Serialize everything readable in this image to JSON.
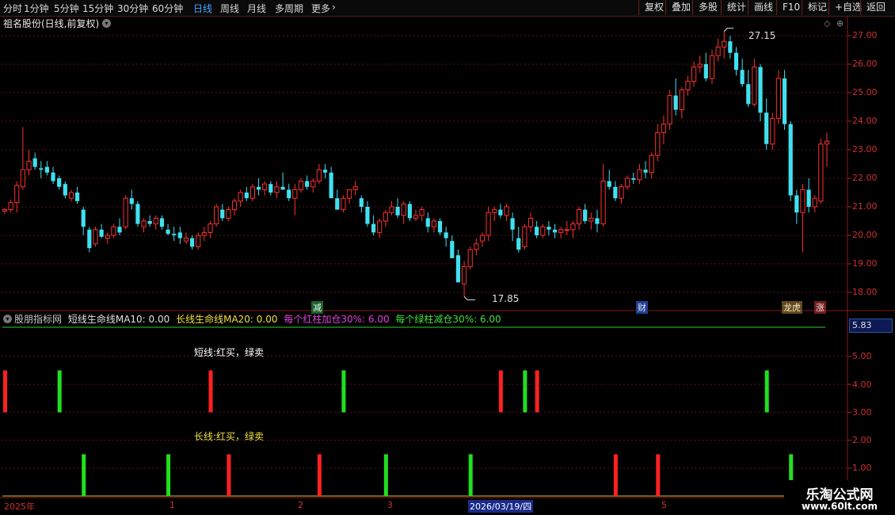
{
  "toolbar": {
    "periods": [
      "分时",
      "1分钟",
      "5分钟",
      "15分钟",
      "30分钟",
      "60分钟",
      "日线",
      "周线",
      "月线",
      "多周期",
      "更多"
    ],
    "active_period": "日线",
    "more_arrow": "›",
    "right_buttons": [
      "复权",
      "叠加",
      "多股",
      "统计",
      "画线",
      "F10",
      "标记",
      "+自选",
      "返回"
    ]
  },
  "stock": {
    "title": "祖名股份(日线,前复权)",
    "dropdown_icon": "chevron-down-icon"
  },
  "price_axis": {
    "ticks": [
      "27.00",
      "26.00",
      "25.00",
      "24.00",
      "23.00",
      "22.00",
      "21.00",
      "20.00",
      "19.00",
      "18.00"
    ]
  },
  "annotations": {
    "high": "27.15",
    "low": "17.85"
  },
  "event_badges": [
    {
      "text": "减",
      "color": "#2fa84f"
    },
    {
      "text": "财",
      "color": "#2f6fd6"
    },
    {
      "text": "龙虎",
      "color": "#b08a2f"
    },
    {
      "text": "涨",
      "color": "#d03030"
    }
  ],
  "indicator": {
    "name": "股朋指标网",
    "items": [
      {
        "text": "短线生命线MA10: 0.00",
        "color": "#e0e0e0"
      },
      {
        "text": "长线生命线MA20: 0.00",
        "color": "#f0e040"
      },
      {
        "text": "每个红柱加仓30%: 6.00",
        "color": "#e040e0"
      },
      {
        "text": "每个绿柱减仓30%: 6.00",
        "color": "#40e040"
      }
    ],
    "short_label": "短线:红买，绿卖",
    "long_label": "长线:红买，绿卖",
    "current_value": "5.83",
    "y_ticks": [
      "5.00",
      "4.00",
      "3.00",
      "2.00",
      "1.00"
    ]
  },
  "x_axis": {
    "labels": [
      "2025年",
      "1",
      "2",
      "3",
      "2026/03/19/四",
      "5"
    ]
  },
  "watermark": {
    "title": "乐淘公式网",
    "url": "www.60lt.com"
  },
  "colors": {
    "up": "#ff3030",
    "down": "#40e0f0",
    "grid": "#5a1414",
    "buy": "#ff2020",
    "sell": "#20e020"
  },
  "chart_data": {
    "type": "candlestick",
    "ylim": [
      17.7,
      27.3
    ],
    "candles": [
      [
        20.85,
        20.95,
        20.75,
        20.9
      ],
      [
        20.9,
        21.25,
        20.8,
        21.15
      ],
      [
        21.15,
        21.9,
        20.8,
        21.75
      ],
      [
        21.7,
        23.8,
        21.6,
        22.3
      ],
      [
        22.3,
        23.0,
        22.1,
        22.6
      ],
      [
        22.7,
        22.9,
        22.3,
        22.4
      ],
      [
        22.35,
        22.6,
        22.0,
        22.3
      ],
      [
        22.4,
        22.6,
        22.1,
        22.2
      ],
      [
        22.2,
        22.4,
        21.8,
        21.9
      ],
      [
        22.0,
        22.1,
        21.6,
        21.7
      ],
      [
        21.8,
        21.9,
        21.3,
        21.4
      ],
      [
        21.3,
        21.6,
        21.2,
        21.5
      ],
      [
        21.5,
        21.7,
        21.1,
        21.2
      ],
      [
        20.9,
        21.0,
        20.0,
        20.3
      ],
      [
        20.2,
        20.3,
        19.4,
        19.55
      ],
      [
        19.7,
        20.3,
        19.6,
        20.2
      ],
      [
        20.2,
        20.4,
        19.9,
        19.95
      ],
      [
        19.9,
        20.1,
        19.7,
        20.0
      ],
      [
        20.0,
        20.4,
        19.9,
        20.3
      ],
      [
        20.3,
        20.6,
        20.0,
        20.1
      ],
      [
        20.3,
        21.4,
        20.2,
        21.3
      ],
      [
        21.3,
        21.6,
        20.9,
        21.1
      ],
      [
        21.1,
        21.2,
        20.3,
        20.4
      ],
      [
        20.3,
        20.6,
        20.1,
        20.5
      ],
      [
        20.5,
        20.7,
        20.3,
        20.4
      ],
      [
        20.4,
        20.7,
        20.2,
        20.6
      ],
      [
        20.6,
        20.7,
        20.2,
        20.3
      ],
      [
        20.2,
        20.4,
        20.0,
        20.05
      ],
      [
        20.05,
        20.3,
        19.8,
        20.0
      ],
      [
        20.1,
        20.3,
        19.7,
        19.9
      ],
      [
        19.8,
        20.1,
        19.7,
        19.9
      ],
      [
        19.9,
        20.0,
        19.5,
        19.6
      ],
      [
        19.6,
        20.1,
        19.5,
        20.0
      ],
      [
        20.0,
        20.3,
        19.8,
        20.1
      ],
      [
        20.1,
        20.5,
        19.9,
        20.4
      ],
      [
        20.4,
        21.1,
        20.3,
        21.0
      ],
      [
        20.9,
        21.1,
        20.5,
        20.6
      ],
      [
        20.6,
        21.0,
        20.5,
        20.9
      ],
      [
        20.9,
        21.3,
        20.7,
        21.2
      ],
      [
        21.2,
        21.6,
        21.0,
        21.5
      ],
      [
        21.5,
        21.7,
        21.2,
        21.3
      ],
      [
        21.3,
        21.8,
        21.2,
        21.7
      ],
      [
        21.7,
        22.0,
        21.4,
        21.6
      ],
      [
        21.6,
        21.9,
        21.4,
        21.8
      ],
      [
        21.8,
        21.9,
        21.4,
        21.5
      ],
      [
        21.5,
        21.9,
        21.3,
        21.7
      ],
      [
        21.7,
        22.2,
        21.6,
        21.6
      ],
      [
        21.6,
        21.8,
        21.2,
        21.3
      ],
      [
        21.3,
        21.8,
        20.7,
        21.6
      ],
      [
        21.6,
        22.0,
        21.5,
        21.9
      ],
      [
        21.9,
        22.1,
        21.6,
        21.7
      ],
      [
        21.7,
        22.0,
        21.5,
        21.9
      ],
      [
        21.9,
        22.5,
        21.8,
        22.3
      ],
      [
        22.3,
        22.5,
        22.0,
        22.2
      ],
      [
        22.2,
        22.4,
        21.5,
        21.3
      ],
      [
        21.3,
        21.6,
        20.9,
        20.9
      ],
      [
        20.9,
        21.4,
        20.8,
        21.3
      ],
      [
        21.3,
        21.6,
        21.1,
        21.6
      ],
      [
        21.6,
        21.9,
        21.4,
        21.7
      ],
      [
        21.3,
        21.4,
        20.8,
        21.0
      ],
      [
        21.0,
        21.2,
        20.3,
        20.4
      ],
      [
        20.4,
        20.7,
        20.0,
        20.1
      ],
      [
        20.1,
        20.6,
        19.9,
        20.5
      ],
      [
        20.5,
        20.9,
        20.3,
        20.8
      ],
      [
        20.8,
        21.2,
        20.7,
        21.0
      ],
      [
        21.0,
        21.3,
        20.6,
        20.7
      ],
      [
        20.7,
        21.2,
        20.4,
        21.1
      ],
      [
        21.1,
        21.2,
        20.5,
        20.6
      ],
      [
        20.6,
        20.9,
        20.5,
        20.7
      ],
      [
        20.7,
        21.0,
        20.5,
        20.9
      ],
      [
        20.6,
        20.8,
        20.1,
        20.3
      ],
      [
        20.3,
        20.6,
        20.1,
        20.5
      ],
      [
        20.5,
        20.6,
        20.0,
        20.1
      ],
      [
        20.1,
        20.3,
        19.6,
        19.9
      ],
      [
        19.8,
        20.0,
        19.3,
        19.2
      ],
      [
        19.3,
        19.5,
        18.8,
        18.35
      ],
      [
        18.3,
        19.1,
        17.85,
        18.9
      ],
      [
        18.9,
        19.6,
        18.8,
        19.5
      ],
      [
        19.5,
        19.9,
        19.3,
        19.7
      ],
      [
        19.8,
        20.1,
        19.6,
        20.0
      ],
      [
        20.0,
        21.0,
        19.8,
        20.8
      ],
      [
        20.8,
        21.0,
        20.5,
        20.9
      ],
      [
        20.9,
        21.1,
        20.6,
        20.7
      ],
      [
        20.7,
        21.1,
        20.5,
        21.0
      ],
      [
        20.6,
        20.8,
        19.8,
        20.2
      ],
      [
        19.9,
        20.3,
        19.4,
        19.5
      ],
      [
        19.6,
        20.4,
        19.5,
        20.3
      ],
      [
        20.3,
        20.8,
        20.1,
        20.6
      ],
      [
        20.3,
        20.5,
        19.9,
        20.0
      ],
      [
        20.0,
        20.4,
        19.9,
        20.3
      ],
      [
        20.3,
        20.5,
        20.0,
        20.2
      ],
      [
        20.2,
        20.4,
        19.9,
        20.1
      ],
      [
        20.1,
        20.3,
        19.9,
        20.2
      ],
      [
        20.2,
        20.5,
        20.0,
        20.2
      ],
      [
        20.2,
        20.5,
        19.9,
        20.4
      ],
      [
        20.4,
        21.0,
        20.2,
        20.9
      ],
      [
        20.9,
        21.1,
        20.4,
        20.5
      ],
      [
        20.5,
        20.8,
        20.2,
        20.6
      ],
      [
        20.6,
        20.9,
        20.1,
        20.4
      ],
      [
        20.4,
        22.5,
        20.3,
        21.9
      ],
      [
        21.9,
        22.3,
        21.6,
        21.7
      ],
      [
        21.7,
        21.9,
        21.2,
        21.3
      ],
      [
        21.3,
        21.8,
        21.1,
        21.7
      ],
      [
        21.7,
        22.1,
        21.6,
        22.0
      ],
      [
        22.0,
        22.2,
        21.8,
        21.95
      ],
      [
        21.95,
        22.5,
        21.8,
        22.3
      ],
      [
        22.3,
        22.6,
        22.0,
        22.2
      ],
      [
        22.2,
        22.9,
        22.0,
        22.8
      ],
      [
        22.8,
        23.9,
        22.6,
        23.6
      ],
      [
        23.6,
        24.2,
        23.2,
        23.9
      ],
      [
        23.9,
        25.1,
        23.7,
        24.9
      ],
      [
        24.9,
        25.5,
        24.2,
        24.4
      ],
      [
        24.4,
        25.2,
        24.1,
        25.1
      ],
      [
        25.1,
        25.6,
        24.9,
        25.4
      ],
      [
        25.4,
        26.1,
        25.2,
        25.9
      ],
      [
        25.9,
        26.3,
        25.7,
        26.0
      ],
      [
        26.0,
        26.4,
        25.4,
        25.5
      ],
      [
        25.5,
        26.5,
        25.3,
        26.3
      ],
      [
        26.3,
        26.9,
        26.1,
        26.6
      ],
      [
        26.6,
        27.15,
        26.2,
        26.8
      ],
      [
        26.8,
        27.0,
        26.2,
        26.4
      ],
      [
        26.4,
        26.6,
        25.6,
        25.8
      ],
      [
        25.8,
        26.2,
        25.2,
        25.3
      ],
      [
        25.3,
        25.8,
        24.5,
        24.6
      ],
      [
        24.6,
        26.2,
        24.5,
        25.9
      ],
      [
        25.9,
        26.0,
        24.0,
        24.3
      ],
      [
        24.3,
        24.8,
        23.0,
        23.2
      ],
      [
        23.2,
        24.3,
        23.0,
        24.1
      ],
      [
        24.1,
        25.8,
        23.9,
        25.5
      ],
      [
        25.5,
        25.8,
        23.7,
        23.9
      ],
      [
        23.9,
        24.0,
        21.2,
        21.4
      ],
      [
        21.4,
        21.6,
        20.4,
        20.8
      ],
      [
        20.8,
        21.8,
        19.4,
        21.6
      ],
      [
        21.6,
        22.0,
        20.8,
        21.0
      ],
      [
        21.0,
        21.4,
        20.8,
        21.3
      ],
      [
        21.2,
        23.4,
        21.1,
        23.2
      ],
      [
        23.2,
        23.6,
        22.4,
        23.3
      ]
    ],
    "short_signals": [
      {
        "i": 0,
        "type": "buy"
      },
      {
        "i": 9,
        "type": "sell"
      },
      {
        "i": 34,
        "type": "buy"
      },
      {
        "i": 56,
        "type": "sell"
      },
      {
        "i": 82,
        "type": "buy"
      },
      {
        "i": 86,
        "type": "sell"
      },
      {
        "i": 88,
        "type": "buy"
      },
      {
        "i": 126,
        "type": "sell"
      }
    ],
    "long_signals": [
      {
        "i": 13,
        "type": "sell"
      },
      {
        "i": 27,
        "type": "sell"
      },
      {
        "i": 37,
        "type": "buy"
      },
      {
        "i": 52,
        "type": "buy"
      },
      {
        "i": 63,
        "type": "sell"
      },
      {
        "i": 77,
        "type": "sell"
      },
      {
        "i": 101,
        "type": "buy"
      },
      {
        "i": 108,
        "type": "buy"
      },
      {
        "i": 130,
        "type": "sell"
      }
    ]
  }
}
